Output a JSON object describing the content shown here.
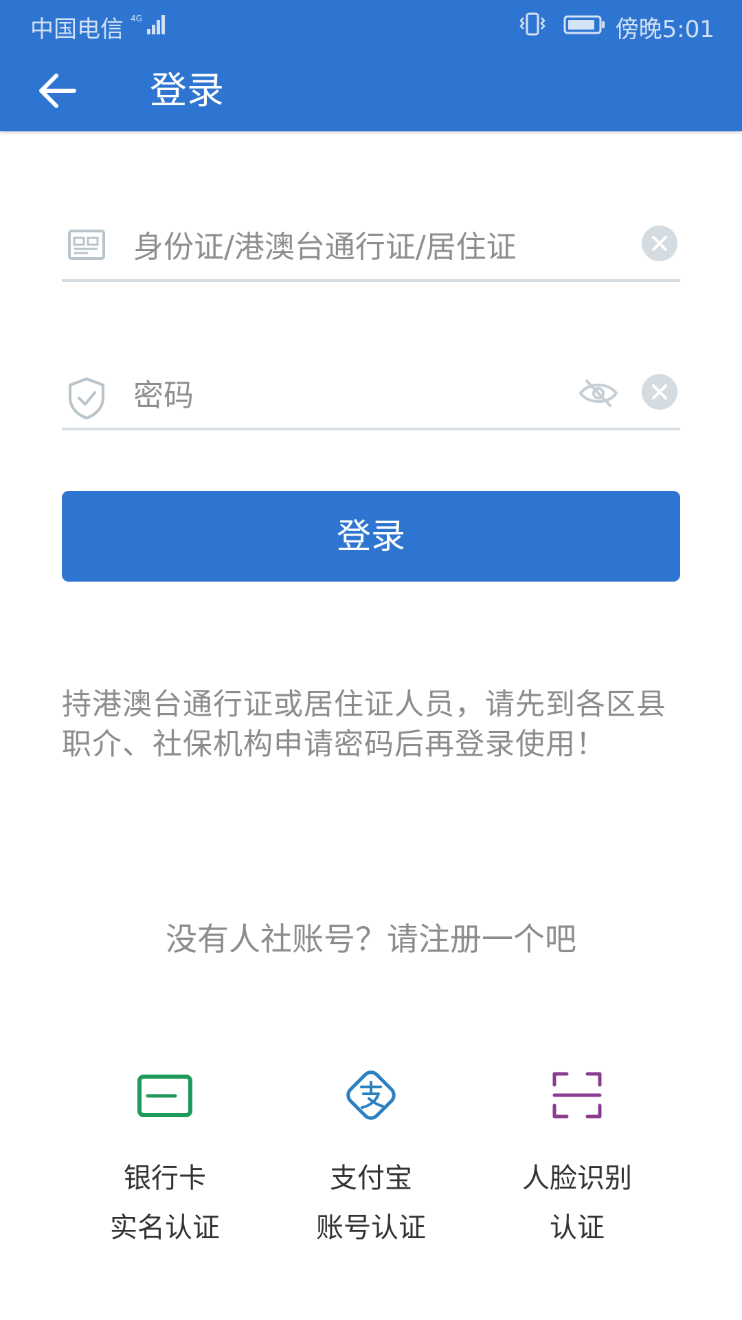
{
  "status_bar": {
    "carrier": "中国电信",
    "network": "4G",
    "time": "傍晚5:01"
  },
  "header": {
    "title": "登录",
    "back_icon": "arrow-left-icon"
  },
  "form": {
    "id_field": {
      "placeholder": "身份证/港澳台通行证/居住证",
      "value": "",
      "icon": "id-card-icon"
    },
    "password_field": {
      "placeholder": "密码",
      "value": "",
      "icon": "shield-check-icon"
    },
    "login_button": "登录"
  },
  "notice": "持港澳台通行证或居住证人员，请先到各区县职介、社保机构申请密码后再登录使用！",
  "register_link": "没有人社账号？请注册一个吧",
  "auth_options": [
    {
      "line1": "银行卡",
      "line2": "实名认证",
      "icon": "bank-card-icon",
      "color": "#1e9a5a"
    },
    {
      "line1": "支付宝",
      "line2": "账号认证",
      "icon": "alipay-icon",
      "color": "#2a80c0"
    },
    {
      "line1": "人脸识别",
      "line2": "认证",
      "icon": "face-scan-icon",
      "color": "#8a3d8f"
    }
  ],
  "colors": {
    "primary": "#2e75d1",
    "muted_text": "#8c8c8c",
    "field_line": "#d6dde2"
  }
}
